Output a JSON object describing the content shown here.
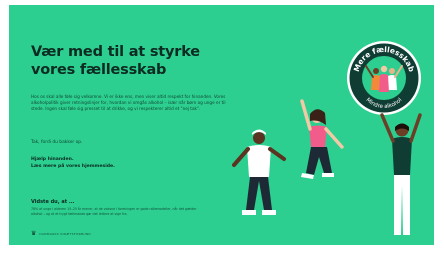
{
  "slide": {
    "title": "Vær med til at styrke vores fællesskab",
    "intro": "Hos os skal alle føle sig velkomne. Vi er ikke ens, men viser altid respekt for hinanden. Vores alkoholpolitik giver retningslinjer for, hvordan vi omgås alkohol – især når børn og unge er til stede. Ingen skal føle sig presset til at drikke, og vi respekterer altid et \"nej tak\".",
    "intro2": "Tak, fordi du bakker op.",
    "cta_line1": "Hjælp hinanden.",
    "cta_line2": "Læs mere på vores hjemmeside.",
    "fact_heading": "Vidste du, at ...",
    "fact_text": "78% af unge i alderen 15–25 år mener, at de voksne i foreningen er gode rollemodeller, når det gælder alkohol – og at et trygt fællesskab gør det lettere at sige fra.",
    "footer_text": "DANMARKS IDRÆTSFORBUND"
  },
  "badge": {
    "top_text": "Mere fællesskab",
    "bottom_text": "Mindre alkohol",
    "ring_color": "#0f3d33",
    "inner_color": "#2ccf8f"
  },
  "colors": {
    "background": "#2ccf8f",
    "text": "#0c2b22",
    "accent_pink": "#f25c8a",
    "accent_orange": "#f28a3a",
    "dark": "#0f3d33"
  }
}
